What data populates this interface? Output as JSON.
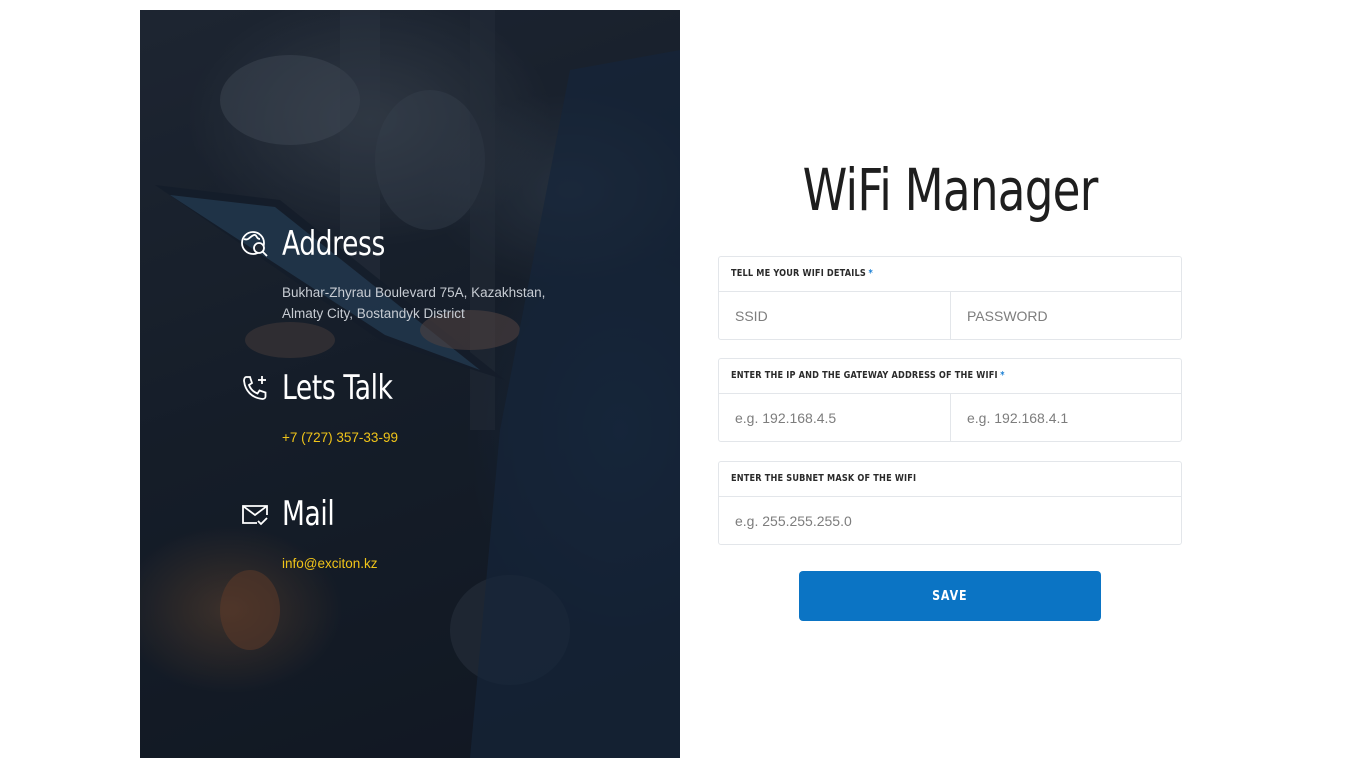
{
  "contact": {
    "address": {
      "icon": "globe-search-icon",
      "title": "Address",
      "text": "Bukhar-Zhyrau Boulevard 75A, Kazakhstan, Almaty City, Bostandyk District"
    },
    "talk": {
      "icon": "phone-plus-icon",
      "title": "Lets Talk",
      "phone": "+7 (727) 357-33-99"
    },
    "mail": {
      "icon": "mail-check-icon",
      "title": "Mail",
      "email": "info@exciton.kz"
    },
    "link_color": "#f0c419"
  },
  "form": {
    "title": "WiFi Manager",
    "groups": [
      {
        "label": "TELL ME YOUR WIFI DETAILS",
        "required": "*",
        "fields": [
          {
            "placeholder": "SSID",
            "value": ""
          },
          {
            "placeholder": "PASSWORD",
            "value": ""
          }
        ]
      },
      {
        "label": "ENTER THE IP AND THE GATEWAY ADDRESS OF THE WIFI",
        "required": "*",
        "fields": [
          {
            "placeholder": "e.g. 192.168.4.5",
            "value": ""
          },
          {
            "placeholder": "e.g. 192.168.4.1",
            "value": ""
          }
        ]
      },
      {
        "label": "ENTER THE SUBNET MASK OF THE WIFI",
        "fields": [
          {
            "placeholder": "e.g. 255.255.255.0",
            "value": ""
          }
        ]
      }
    ],
    "save_label": "SAVE",
    "accent_color": "#0b74c4",
    "required_color": "#1a7fd4"
  }
}
